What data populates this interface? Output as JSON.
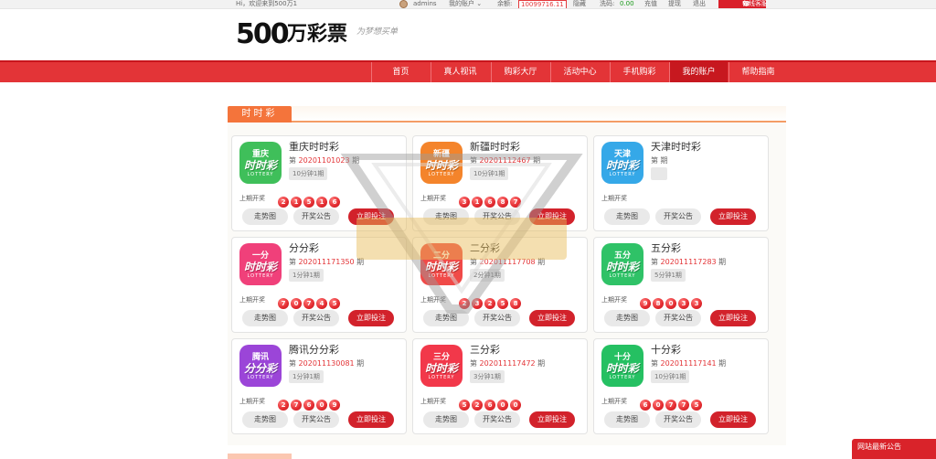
{
  "topbar": {
    "welcome": "Hi，欢迎来到500万1",
    "username": "admins",
    "my_account": "我的账户",
    "balance_label": "余额:",
    "balance_value": "10099716.11",
    "hide_label": "隐藏",
    "wash_label": "洗码:",
    "wash_value": "0.00",
    "recharge": "充值",
    "withdraw": "提现",
    "logout": "退出",
    "customer_service": "在线客服"
  },
  "header": {
    "logo_num": "500",
    "logo_text": "万彩票",
    "slogan": "为梦想买单"
  },
  "nav": [
    "首页",
    "真人视讯",
    "购彩大厅",
    "活动中心",
    "手机购彩",
    "我的账户",
    "帮助指南"
  ],
  "nav_active": "我的账户",
  "section": {
    "title": "时时彩"
  },
  "common": {
    "issue_prefix": "第",
    "issue_suffix": "期",
    "last_label": "上期开奖",
    "btn_trend": "走势图",
    "btn_notice": "开奖公告",
    "btn_bet": "立即投注"
  },
  "games": [
    {
      "name": "重庆时时彩",
      "icon_top": "重庆",
      "icon_main": "时时彩",
      "icon_sub": "LOTTERY",
      "color": "#3fbf5a",
      "issue": "20201101023",
      "period": "10分钟1期",
      "balls": [
        "2",
        "1",
        "5",
        "1",
        "6"
      ]
    },
    {
      "name": "新疆时时彩",
      "icon_top": "新疆",
      "icon_main": "时时彩",
      "icon_sub": "LOTTERY",
      "color": "#f4842b",
      "issue": "20201112467",
      "period": "10分钟1期",
      "balls": [
        "3",
        "1",
        "6",
        "8",
        "7"
      ]
    },
    {
      "name": "天津时时彩",
      "icon_top": "天津",
      "icon_main": "时时彩",
      "icon_sub": "LOTTERY",
      "color": "#35a8e8",
      "issue": "",
      "period": "",
      "balls": []
    },
    {
      "name": "分分彩",
      "icon_top": "一分",
      "icon_main": "时时彩",
      "icon_sub": "LOTTERY",
      "color": "#f0407a",
      "issue": "202011171350",
      "period": "1分钟1期",
      "balls": [
        "7",
        "0",
        "7",
        "4",
        "5"
      ]
    },
    {
      "name": "二分彩",
      "icon_top": "二分",
      "icon_main": "时时彩",
      "icon_sub": "LOTTERY",
      "color": "#f04a48",
      "issue": "202011117708",
      "period": "2分钟1期",
      "balls": [
        "2",
        "3",
        "2",
        "5",
        "8"
      ]
    },
    {
      "name": "五分彩",
      "icon_top": "五分",
      "icon_main": "时时彩",
      "icon_sub": "LOTTERY",
      "color": "#2fc267",
      "issue": "202011117283",
      "period": "5分钟1期",
      "balls": [
        "9",
        "8",
        "0",
        "3",
        "3"
      ]
    },
    {
      "name": "腾讯分分彩",
      "icon_top": "腾讯",
      "icon_main": "分分彩",
      "icon_sub": "LOTTERY",
      "color": "#9b45d8",
      "issue": "202011130081",
      "period": "1分钟1期",
      "balls": [
        "2",
        "7",
        "6",
        "0",
        "9"
      ]
    },
    {
      "name": "三分彩",
      "icon_top": "三分",
      "icon_main": "时时彩",
      "icon_sub": "LOTTERY",
      "color": "#f2384a",
      "issue": "202011117472",
      "period": "3分钟1期",
      "balls": [
        "5",
        "2",
        "6",
        "0",
        "0"
      ]
    },
    {
      "name": "十分彩",
      "icon_top": "十分",
      "icon_main": "时时彩",
      "icon_sub": "LOTTERY",
      "color": "#25c062",
      "issue": "202011117141",
      "period": "10分钟1期",
      "balls": [
        "6",
        "0",
        "7",
        "7",
        "5"
      ]
    }
  ],
  "notice_bar": "网站最新公告"
}
